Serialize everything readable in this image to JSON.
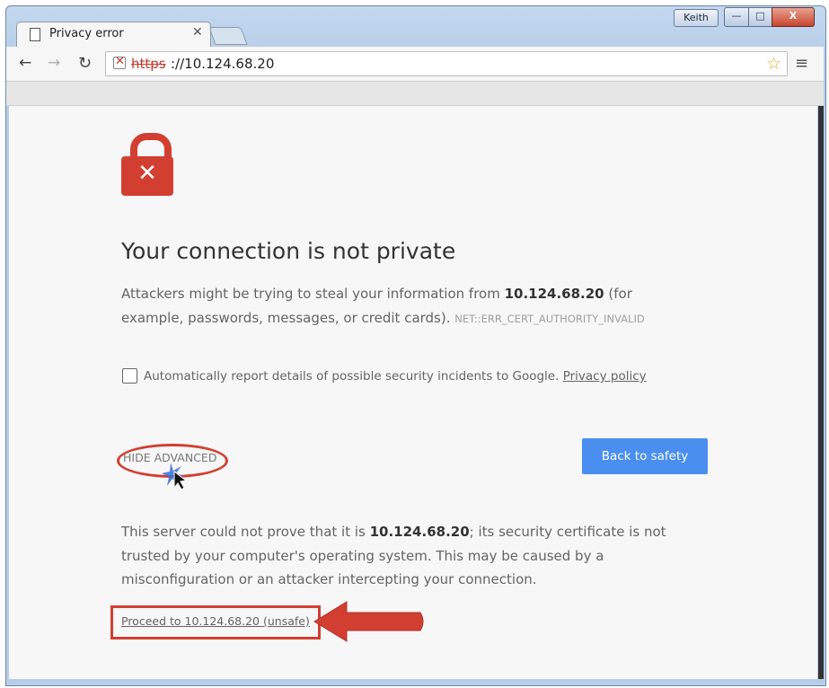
{
  "titlebar": {
    "user": "Keith",
    "minimize": "—",
    "maximize": "□",
    "close": "X"
  },
  "tab": {
    "title": "Privacy error",
    "close": "✕"
  },
  "toolbar": {
    "back": "←",
    "forward": "→",
    "reload": "↻",
    "url_scheme": "https",
    "url_rest": "://10.124.68.20",
    "star": "☆",
    "menu": "≡"
  },
  "page": {
    "headline": "Your connection is not private",
    "intro_before": "Attackers might be trying to steal your information from ",
    "host": "10.124.68.20",
    "intro_after": " (for example, passwords, messages, or credit cards). ",
    "error_code": "NET::ERR_CERT_AUTHORITY_INVALID",
    "checkbox_label": "Automatically report details of possible security incidents to Google. ",
    "privacy_link": "Privacy policy",
    "hide_advanced": "HIDE ADVANCED",
    "back_button": "Back to safety",
    "detail_before": "This server could not prove that it is ",
    "detail_host": "10.124.68.20",
    "detail_after": "; its security certificate is not trusted by your computer's operating system. This may be caused by a misconfiguration or an attacker intercepting your connection.",
    "proceed_link": "Proceed to 10.124.68.20 (unsafe)"
  },
  "colors": {
    "danger_red": "#d23f31",
    "button_blue": "#4a8ff0"
  }
}
